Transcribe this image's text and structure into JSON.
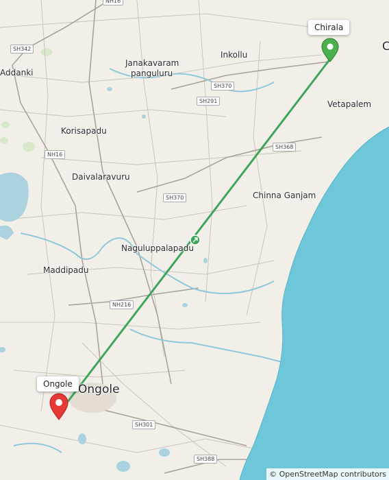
{
  "map": {
    "places": {
      "addanki": "Addanki",
      "janakavaram": "Janakavaram",
      "panguluru": "panguluru",
      "inkollu": "Inkollu",
      "vetapalem": "Vetapalem",
      "korisapadu": "Korisapadu",
      "daivalaravuru": "Daivalaravuru",
      "chinna_ganjam": "Chinna Ganjam",
      "naguluppalapadu": "Naguluppalapadu",
      "maddipadu": "Maddipadu",
      "ongole_city": "Ongole",
      "chirala_partial": "C"
    },
    "roads": {
      "sh342": "SH342",
      "sh370_a": "SH370",
      "sh291": "SH291",
      "nh16": "NH16",
      "sh368": "SH368",
      "sh370_b": "SH370",
      "nh216": "NH216",
      "sh301": "SH301",
      "sh388": "SH388",
      "top_partial": "NH16"
    },
    "markers": {
      "start": {
        "label": "Chirala",
        "color": "#4caf50"
      },
      "end": {
        "label": "Ongole",
        "color": "#e53935"
      }
    },
    "route": {
      "color": "#3ea55a",
      "icon": "route-direction-icon"
    },
    "colors": {
      "sea": "#6ec6d9",
      "land": "#f2efe9",
      "water": "#aad3df"
    },
    "attribution": "© OpenStreetMap contributors"
  }
}
